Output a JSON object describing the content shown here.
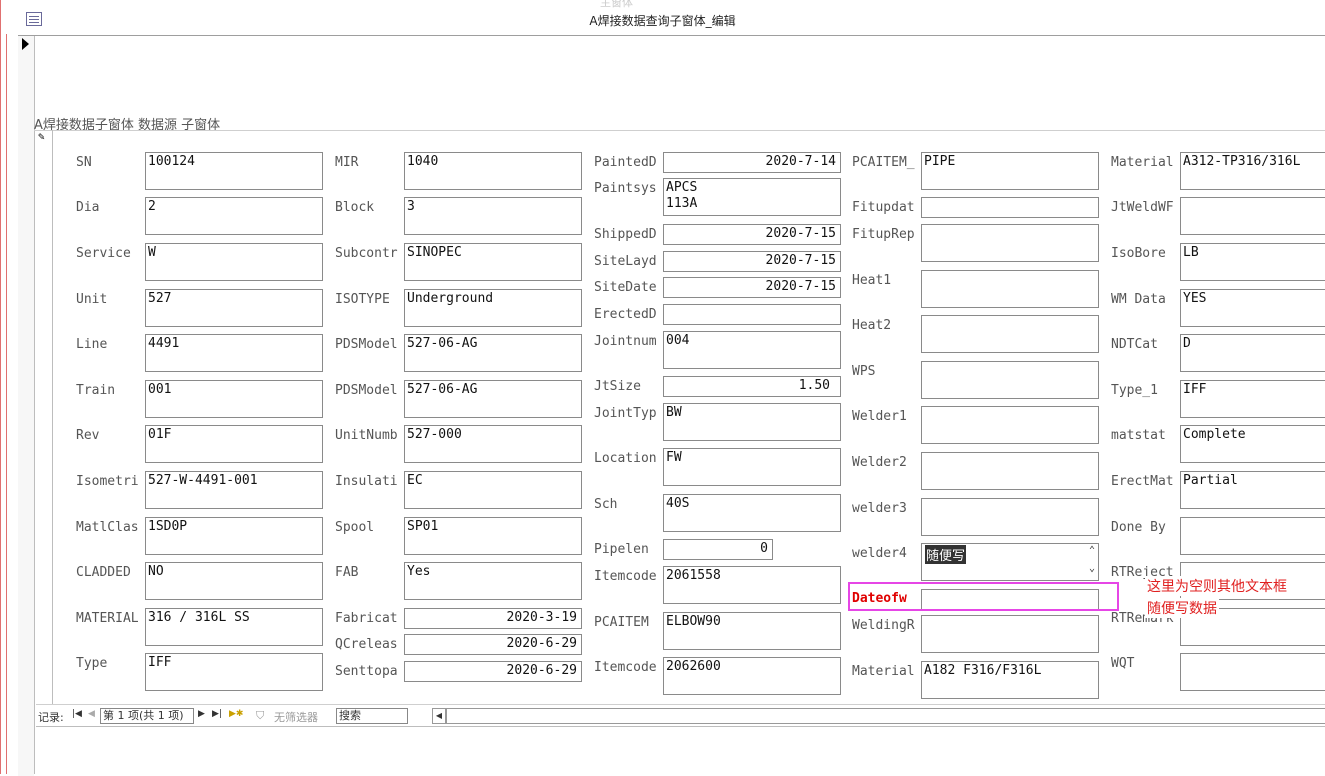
{
  "window": {
    "title": "A焊接数据查询子窗体_编辑",
    "ghost_title": "主窗体"
  },
  "subform": {
    "caption": "A焊接数据子窗体 数据源 子窗体"
  },
  "fields": {
    "sn": {
      "label": "SN",
      "value": "100124"
    },
    "dia": {
      "label": "Dia",
      "value": "2"
    },
    "service": {
      "label": "Service",
      "value": "W"
    },
    "unit": {
      "label": "Unit",
      "value": "527"
    },
    "line": {
      "label": "Line",
      "value": "4491"
    },
    "train": {
      "label": "Train",
      "value": "001"
    },
    "rev": {
      "label": "Rev",
      "value": "01F"
    },
    "isometri": {
      "label": "Isometri",
      "value": "527-W-4491-001"
    },
    "matlclas": {
      "label": "MatlClas",
      "value": "1SD0P"
    },
    "cladded": {
      "label": "CLADDED",
      "value": "NO"
    },
    "material1": {
      "label": "MATERIAL",
      "value": "316 / 316L SS"
    },
    "type": {
      "label": "Type",
      "value": "IFF"
    },
    "mir": {
      "label": "MIR",
      "value": "1040"
    },
    "block": {
      "label": "Block",
      "value": "3"
    },
    "subcontr": {
      "label": "Subcontr",
      "value": "SINOPEC"
    },
    "isotype": {
      "label": "ISOTYPE",
      "value": "Underground"
    },
    "pdsmodel1": {
      "label": "PDSModel",
      "value": "527-06-AG"
    },
    "pdsmodel2": {
      "label": "PDSModel",
      "value": "527-06-AG"
    },
    "unitnumb": {
      "label": "UnitNumb",
      "value": "527-000"
    },
    "insulati": {
      "label": "Insulati",
      "value": "EC"
    },
    "spool": {
      "label": "Spool",
      "value": "SP01"
    },
    "fab": {
      "label": "FAB",
      "value": "Yes"
    },
    "fabricat": {
      "label": "Fabricat",
      "value": "2020-3-19"
    },
    "qcreleas": {
      "label": "QCreleas",
      "value": "2020-6-29"
    },
    "senttopa": {
      "label": "Senttopa",
      "value": "2020-6-29"
    },
    "paintedd": {
      "label": "PaintedD",
      "value": "2020-7-14"
    },
    "paintsys": {
      "label": "Paintsys",
      "value": "APCS\n113A"
    },
    "shippedd": {
      "label": "ShippedD",
      "value": "2020-7-15"
    },
    "sitelayd": {
      "label": "SiteLayd",
      "value": "2020-7-15"
    },
    "sitedate": {
      "label": "SiteDate",
      "value": "2020-7-15"
    },
    "erectedd": {
      "label": "ErectedD",
      "value": ""
    },
    "jointnum": {
      "label": "Jointnum",
      "value": "004"
    },
    "jtsize": {
      "label": "JtSize",
      "value": "1.50"
    },
    "jointtyp": {
      "label": "JointTyp",
      "value": "BW"
    },
    "location": {
      "label": "Location",
      "value": "FW"
    },
    "sch": {
      "label": "Sch",
      "value": "40S"
    },
    "pipelen": {
      "label": "Pipelen",
      "value": "0"
    },
    "itemcode1": {
      "label": "Itemcode",
      "value": "2061558"
    },
    "pcaitem": {
      "label": "PCAITEM",
      "value": "ELBOW90"
    },
    "itemcode2": {
      "label": "Itemcode",
      "value": "2062600"
    },
    "pcaitem_": {
      "label": "PCAITEM_",
      "value": "PIPE"
    },
    "fitupdat": {
      "label": "Fitupdat",
      "value": ""
    },
    "fituprep": {
      "label": "FitupRep",
      "value": ""
    },
    "heat1": {
      "label": "Heat1",
      "value": ""
    },
    "heat2": {
      "label": "Heat2",
      "value": ""
    },
    "wps": {
      "label": "WPS",
      "value": ""
    },
    "welder1": {
      "label": "Welder1",
      "value": ""
    },
    "welder2": {
      "label": "Welder2",
      "value": ""
    },
    "welder3": {
      "label": "welder3",
      "value": ""
    },
    "welder4": {
      "label": "welder4",
      "value": "随便写"
    },
    "dateofw": {
      "label": "Dateofw",
      "value": ""
    },
    "weldingr": {
      "label": "WeldingR",
      "value": ""
    },
    "material3": {
      "label": "Material",
      "value": "A182 F316/F316L"
    },
    "material2": {
      "label": "Material",
      "value": "A312-TP316/316L"
    },
    "jtweldwf": {
      "label": "JtWeldWF",
      "value": ""
    },
    "isobore": {
      "label": "IsoBore",
      "value": "LB"
    },
    "wmdata": {
      "label": "WM Data",
      "value": "YES"
    },
    "ndtcat": {
      "label": "NDTCat",
      "value": "D"
    },
    "type_1": {
      "label": "Type_1",
      "value": "IFF"
    },
    "matstat": {
      "label": "matstat",
      "value": "Complete"
    },
    "erectmat": {
      "label": "ErectMat",
      "value": "Partial"
    },
    "doneby": {
      "label": "Done By",
      "value": ""
    },
    "rtreject": {
      "label": "RTReject",
      "value": ""
    },
    "rtremark": {
      "label": "RTRemark",
      "value": ""
    },
    "wqt": {
      "label": "WQT",
      "value": ""
    }
  },
  "navigation": {
    "records_label": "记录:",
    "current": "第 1 项(共 1 项)",
    "filter": "无筛选器",
    "search": "搜索"
  },
  "annotation": {
    "line1": "这里为空则其他文本框",
    "line2": "随便写数据",
    "color": "#e646e6",
    "text_color": "#e02020"
  }
}
